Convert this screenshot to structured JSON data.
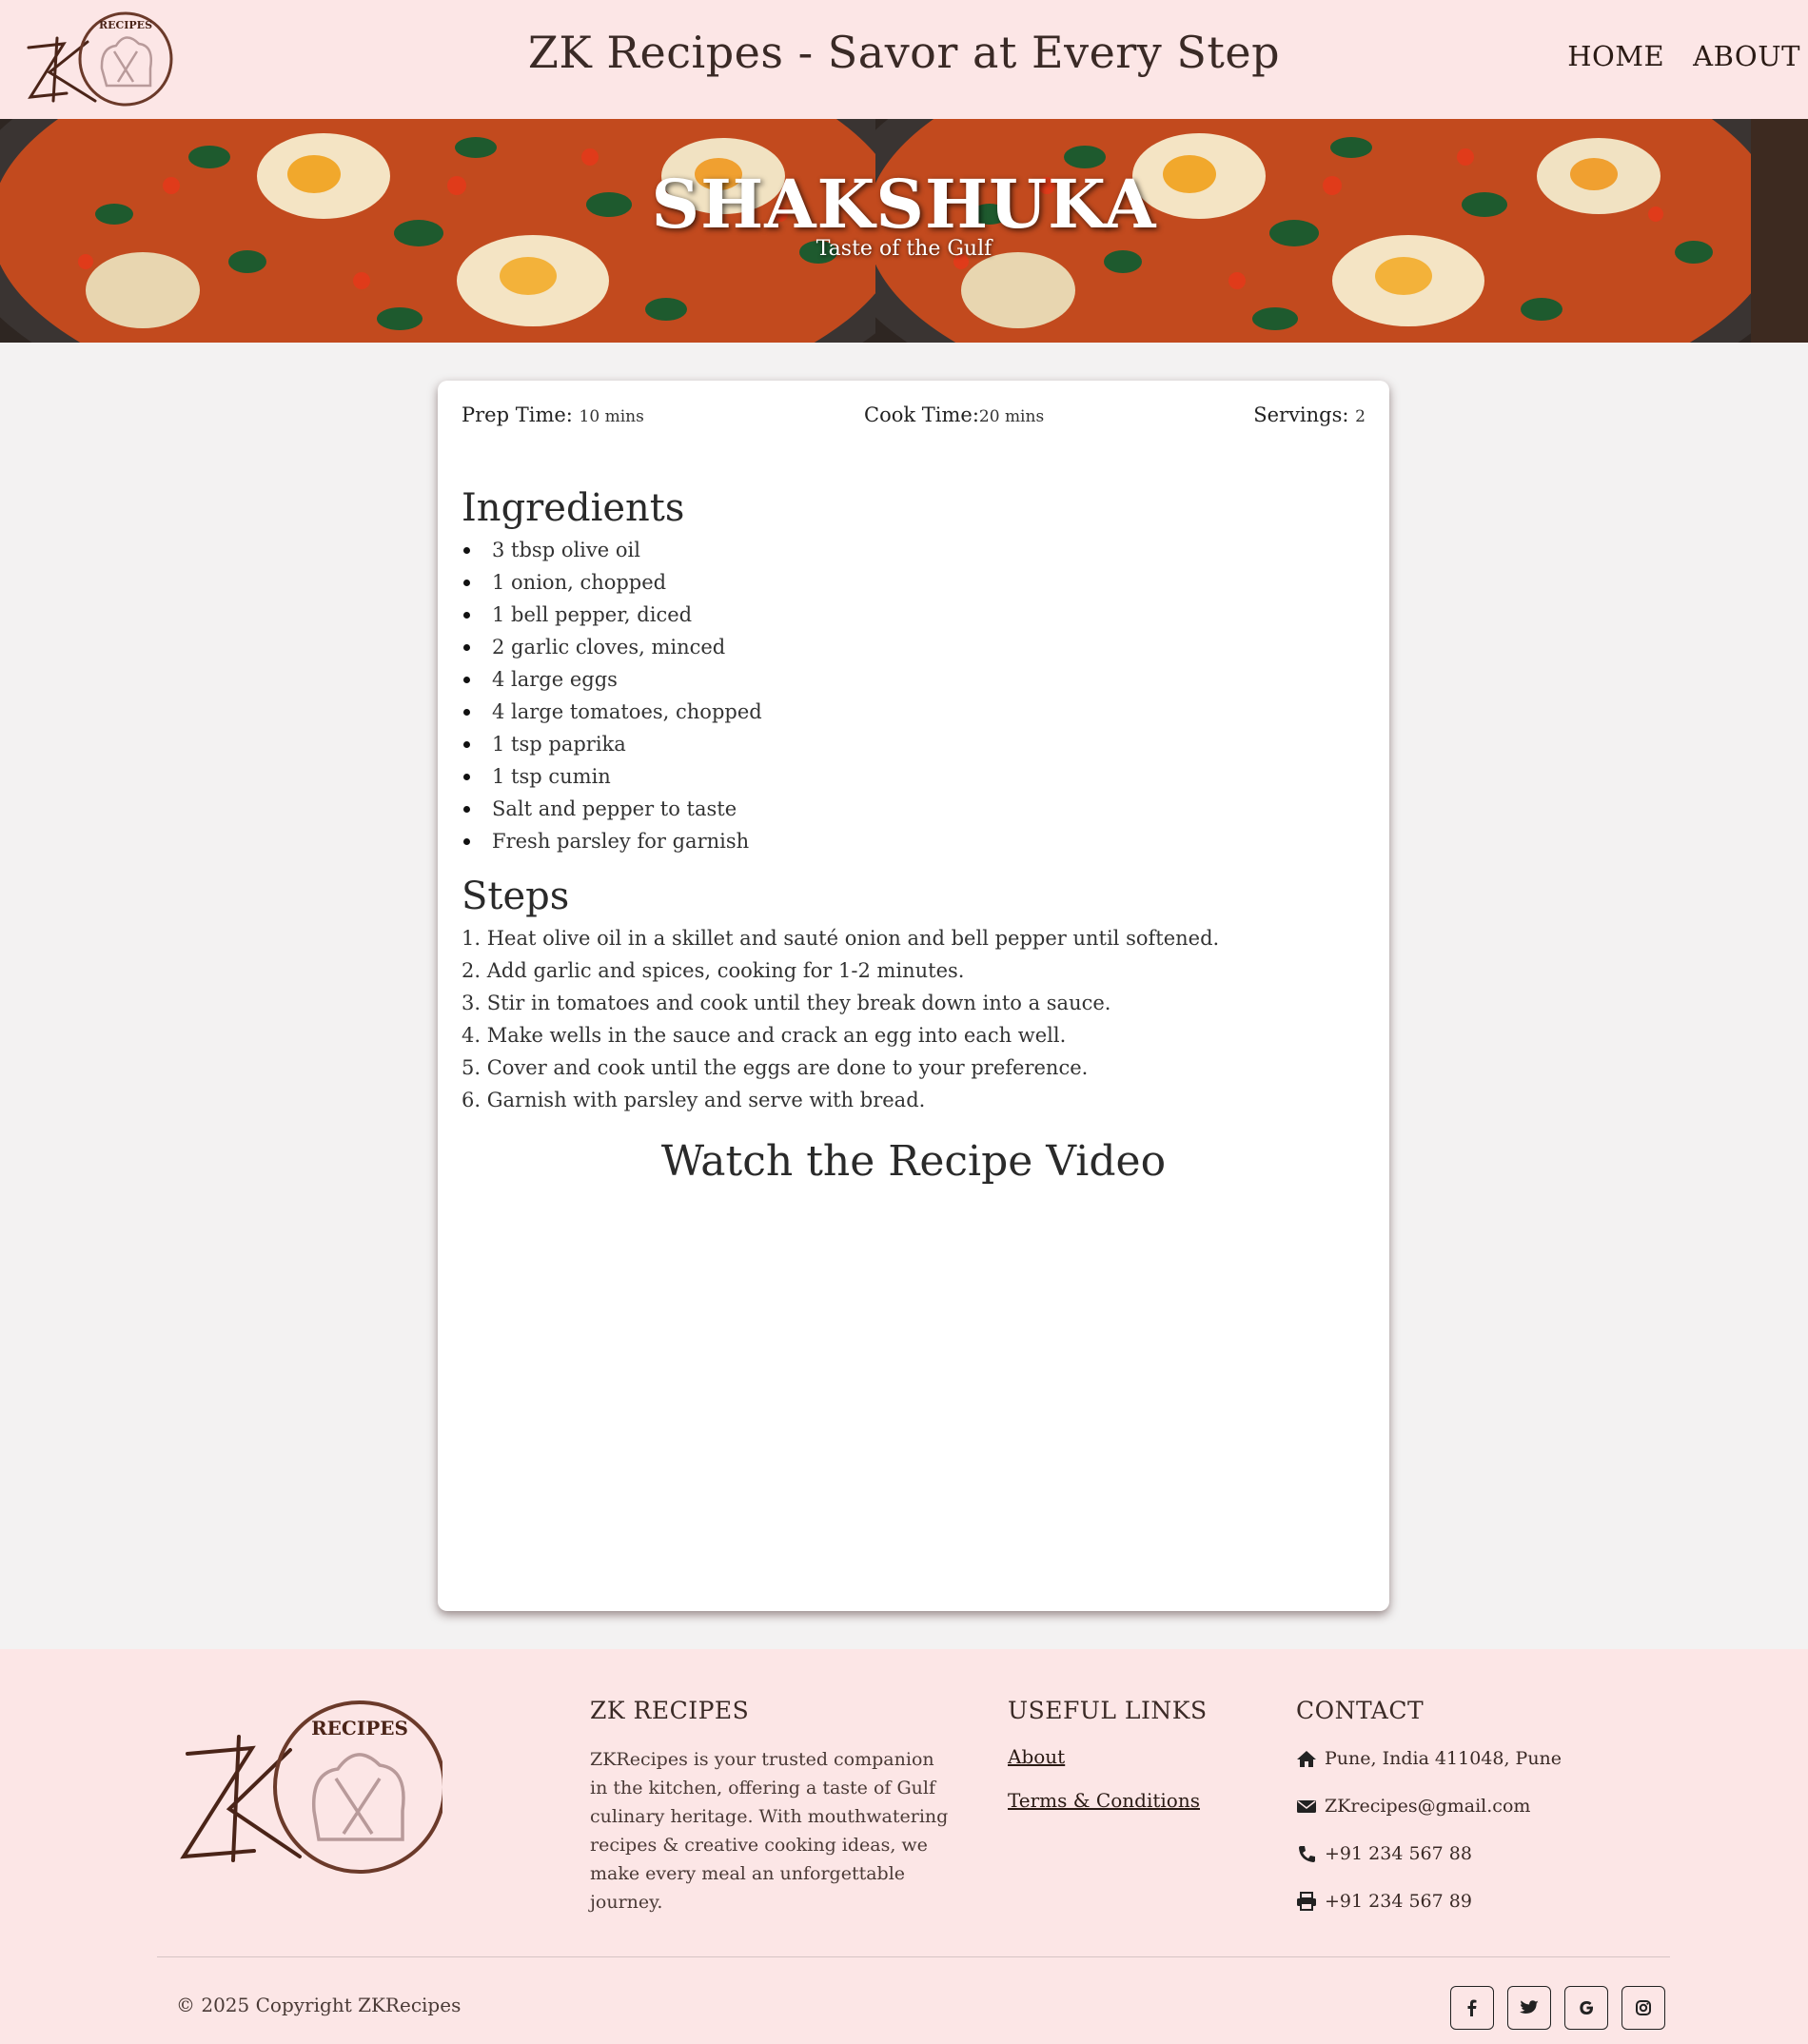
{
  "header": {
    "title": "ZK Recipes - Savor at Every Step",
    "logo_text": "RECIPES",
    "nav": [
      {
        "label": "HOME"
      },
      {
        "label": "ABOUT"
      }
    ]
  },
  "hero": {
    "title": "SHAKSHUKA",
    "subtitle": "Taste of the Gulf"
  },
  "recipe": {
    "prep_label": "Prep Time:",
    "prep_value": "10 mins",
    "cook_label": "Cook Time:",
    "cook_value": "20 mins",
    "servings_label": "Servings:",
    "servings_value": "2",
    "ingredients_title": "Ingredients",
    "ingredients": [
      "3 tbsp olive oil",
      "1 onion, chopped",
      "1 bell pepper, diced",
      "2 garlic cloves, minced",
      "4 large eggs",
      "4 large tomatoes, chopped",
      "1 tsp paprika",
      "1 tsp cumin",
      "Salt and pepper to taste",
      "Fresh parsley for garnish"
    ],
    "steps_title": "Steps",
    "steps": [
      "1. Heat olive oil in a skillet and sauté onion and bell pepper until softened.",
      "2. Add garlic and spices, cooking for 1-2 minutes.",
      "3. Stir in tomatoes and cook until they break down into a sauce.",
      "4. Make wells in the sauce and crack an egg into each well.",
      "5. Cover and cook until the eggs are done to your preference.",
      "6. Garnish with parsley and serve with bread."
    ],
    "video_title": "Watch the Recipe Video"
  },
  "footer": {
    "logo_text": "RECIPES",
    "about_title": "ZK RECIPES",
    "about_text": "ZKRecipes is your trusted companion in the kitchen, offering a taste of Gulf culinary heritage. With mouthwatering recipes & creative cooking ideas, we make every meal an unforgettable journey.",
    "links_title": "USEFUL LINKS",
    "links": [
      {
        "label": "About"
      },
      {
        "label": "Terms & Conditions"
      }
    ],
    "contact_title": "CONTACT",
    "contact": [
      {
        "icon": "home-icon",
        "text": "Pune, India 411048, Pune"
      },
      {
        "icon": "envelope-icon",
        "text": "ZKrecipes@gmail.com"
      },
      {
        "icon": "phone-icon",
        "text": "+91 234 567 88"
      },
      {
        "icon": "printer-icon",
        "text": "+91 234 567 89"
      }
    ],
    "copyright": "© 2025 Copyright ZKRecipes",
    "socials": [
      "facebook-icon",
      "twitter-icon",
      "google-icon",
      "instagram-icon"
    ]
  },
  "colors": {
    "header_bg": "#fce6e6",
    "page_bg": "#f3f2f2",
    "brand_brown": "#6b3a2a"
  }
}
